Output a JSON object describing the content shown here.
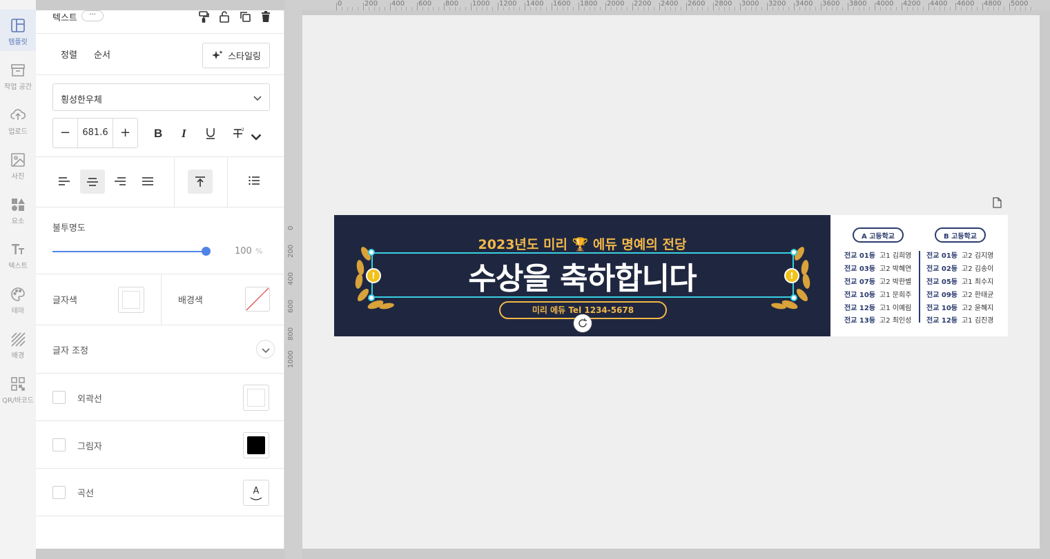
{
  "rail": {
    "items": [
      {
        "label": "템플릿",
        "icon": "template-icon",
        "active": true
      },
      {
        "label": "작업 공간",
        "icon": "archive-icon"
      },
      {
        "label": "업로드",
        "icon": "upload-cloud-icon"
      },
      {
        "label": "사진",
        "icon": "image-icon"
      },
      {
        "label": "요소",
        "icon": "shapes-icon"
      },
      {
        "label": "텍스트",
        "icon": "text-icon"
      },
      {
        "label": "테마",
        "icon": "palette-icon"
      },
      {
        "label": "배경",
        "icon": "background-icon"
      },
      {
        "label": "QR/바코드",
        "icon": "qr-icon"
      }
    ]
  },
  "panel": {
    "header": {
      "title": "텍스트",
      "more": "···"
    },
    "tabs": {
      "align": "정렬",
      "order": "순서",
      "styling": "스타일링"
    },
    "font": {
      "family": "횡성한우체",
      "size": "681.6",
      "minus": "−",
      "plus": "+"
    },
    "opacity": {
      "label": "불투명도",
      "value": "100",
      "unit": "%"
    },
    "colors": {
      "text_label": "글자색",
      "bg_label": "배경색"
    },
    "spacing": {
      "label": "글자 조정"
    },
    "effects": {
      "outline": "외곽선",
      "shadow": "그림자",
      "curve": "곡선",
      "curve_glyph": "A"
    }
  },
  "ruler": {
    "h_labels": [
      "0",
      "200",
      "400",
      "600",
      "800",
      "1000",
      "1200",
      "1400",
      "1600",
      "1800",
      "2000",
      "2200",
      "2400",
      "2600",
      "2800",
      "3000",
      "3200",
      "3400",
      "3600",
      "3800",
      "4000",
      "4200",
      "4400",
      "4600",
      "4800",
      "5000"
    ],
    "v_labels": [
      "0",
      "200",
      "400",
      "600",
      "800",
      "1000"
    ]
  },
  "banner": {
    "subtitle": "2023년도 미리 🏆 에듀 명예의 전당",
    "title": "수상을 축하합니다",
    "contact": "미리 에듀  Tel 1234-5678",
    "school_a": "A 고등학교",
    "school_b": "B 고등학교",
    "list_a": [
      {
        "rank": "전교 01등",
        "name": "고1 김희영"
      },
      {
        "rank": "전교 03등",
        "name": "고2 박혜연"
      },
      {
        "rank": "전교 07등",
        "name": "고2 박한별"
      },
      {
        "rank": "전교 10등",
        "name": "고1 문희주"
      },
      {
        "rank": "전교 12등",
        "name": "고1 이예림"
      },
      {
        "rank": "전교 13등",
        "name": "고2 최인성"
      }
    ],
    "list_b": [
      {
        "rank": "전교 01등",
        "name": "고2 김지영"
      },
      {
        "rank": "전교 02등",
        "name": "고2 김송이"
      },
      {
        "rank": "전교 05등",
        "name": "고1 최수지"
      },
      {
        "rank": "전교 09등",
        "name": "고2 한태균"
      },
      {
        "rank": "전교 10등",
        "name": "고2 윤혜지"
      },
      {
        "rank": "전교 12등",
        "name": "고1 김진경"
      }
    ],
    "colors": {
      "navy": "#1f2740",
      "gold": "#f3b84a",
      "cyan": "#3ad0e2"
    }
  }
}
